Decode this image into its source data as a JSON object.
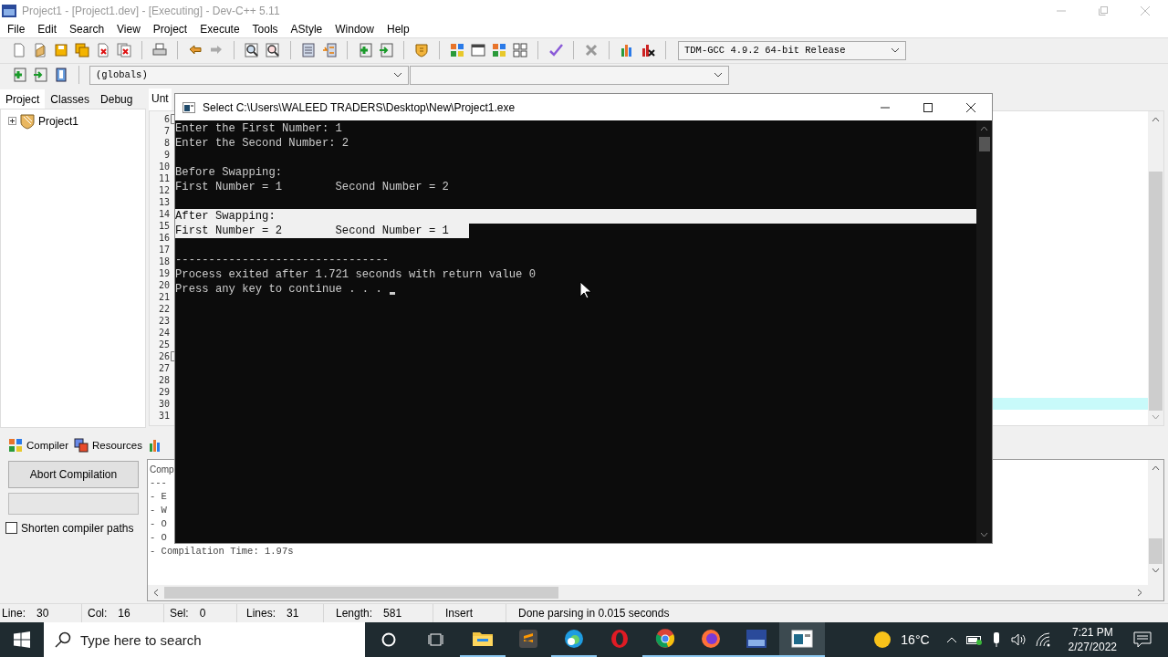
{
  "window": {
    "title": "Project1 - [Project1.dev] - [Executing] - Dev-C++ 5.11"
  },
  "menu": [
    "File",
    "Edit",
    "Search",
    "View",
    "Project",
    "Execute",
    "Tools",
    "AStyle",
    "Window",
    "Help"
  ],
  "toolbar": {
    "compiler": "TDM-GCC 4.9.2 64-bit Release",
    "scope": "(globals)"
  },
  "left_panel": {
    "tabs": [
      {
        "label": "Project",
        "selected": true
      },
      {
        "label": "Classes",
        "selected": false
      },
      {
        "label": "Debug",
        "selected": false
      }
    ],
    "tree": [
      {
        "label": "Project1",
        "expanded": false
      }
    ]
  },
  "editor": {
    "tab": "Unt",
    "lines": [
      {
        "number": "6",
        "fold": true,
        "current": false
      },
      {
        "number": "7",
        "fold": false,
        "current": false
      },
      {
        "number": "8",
        "fold": false,
        "current": false
      },
      {
        "number": "9",
        "fold": false,
        "current": false
      },
      {
        "number": "10",
        "fold": false,
        "current": false
      },
      {
        "number": "11",
        "fold": false,
        "current": false
      },
      {
        "number": "12",
        "fold": false,
        "current": false
      },
      {
        "number": "13",
        "fold": false,
        "current": false
      },
      {
        "number": "14",
        "fold": false,
        "current": false
      },
      {
        "number": "15",
        "fold": false,
        "current": false
      },
      {
        "number": "16",
        "fold": false,
        "current": false
      },
      {
        "number": "17",
        "fold": false,
        "current": false
      },
      {
        "number": "18",
        "fold": false,
        "current": false
      },
      {
        "number": "19",
        "fold": false,
        "current": false
      },
      {
        "number": "20",
        "fold": false,
        "current": false
      },
      {
        "number": "21",
        "fold": false,
        "current": false
      },
      {
        "number": "22",
        "fold": false,
        "current": false
      },
      {
        "number": "23",
        "fold": false,
        "current": false
      },
      {
        "number": "24",
        "fold": false,
        "current": false
      },
      {
        "number": "25",
        "fold": false,
        "current": false
      },
      {
        "number": "26",
        "fold": true,
        "current": false
      },
      {
        "number": "27",
        "fold": false,
        "current": false
      },
      {
        "number": "28",
        "fold": false,
        "current": false
      },
      {
        "number": "29",
        "fold": false,
        "current": false
      },
      {
        "number": "30",
        "fold": false,
        "current": true
      },
      {
        "number": "31",
        "fold": false,
        "current": false
      }
    ]
  },
  "console": {
    "title": "Select C:\\Users\\WALEED TRADERS\\Desktop\\New\\Project1.exe",
    "lines": [
      {
        "kind": "text",
        "text": "Enter the First Number: 1",
        "selected": false
      },
      {
        "kind": "text",
        "text": "Enter the Second Number: 2",
        "selected": false
      },
      {
        "kind": "blank",
        "selected": false
      },
      {
        "kind": "text",
        "text": "Before Swapping:",
        "selected": false
      },
      {
        "kind": "text",
        "text": "First Number = 1        Second Number = 2",
        "selected": false
      },
      {
        "kind": "blank",
        "selected": false
      },
      {
        "kind": "text",
        "text": "After Swapping:",
        "selected": true
      },
      {
        "kind": "text",
        "text": "First Number = 2        Second Number = 1",
        "selected": true
      },
      {
        "kind": "blank",
        "selected": false
      },
      {
        "kind": "text",
        "text": "--------------------------------",
        "selected": false
      },
      {
        "kind": "text",
        "text": "Process exited after 1.721 seconds with return value 0",
        "selected": false
      },
      {
        "kind": "prompt",
        "text": "Press any key to continue . . .",
        "selected": false
      }
    ]
  },
  "bottom_panel": {
    "tabs": [
      "Compiler",
      "Resources"
    ],
    "abort_button": "Abort Compilation",
    "progress": {
      "level": 0
    },
    "shorten_paths": {
      "label": "Shorten compiler paths",
      "checked": false
    },
    "log": [
      "Comp",
      "---",
      "- E",
      "- W",
      "- O",
      "- O",
      "- Compilation Time: 1.97s"
    ]
  },
  "status_bar": {
    "fields": [
      {
        "label": "Line:",
        "value": "30"
      },
      {
        "label": "Col:",
        "value": "16"
      },
      {
        "label": "Sel:",
        "value": "0"
      },
      {
        "label": "Lines:",
        "value": "31"
      },
      {
        "label": "Length:",
        "value": "581"
      }
    ],
    "mode": "Insert",
    "message": "Done parsing in 0.015 seconds"
  },
  "taskbar": {
    "search": {
      "placeholder": "Type here to search"
    },
    "apps": [
      {
        "running": true,
        "active": false
      },
      {
        "running": false,
        "active": false
      },
      {
        "running": true,
        "active": false
      },
      {
        "running": false,
        "active": false
      },
      {
        "running": true,
        "active": false
      },
      {
        "running": true,
        "active": false
      },
      {
        "running": true,
        "active": false
      },
      {
        "running": true,
        "active": true
      }
    ],
    "temperature": "16°C",
    "time": "7:21 PM",
    "date": "2/27/2022"
  }
}
